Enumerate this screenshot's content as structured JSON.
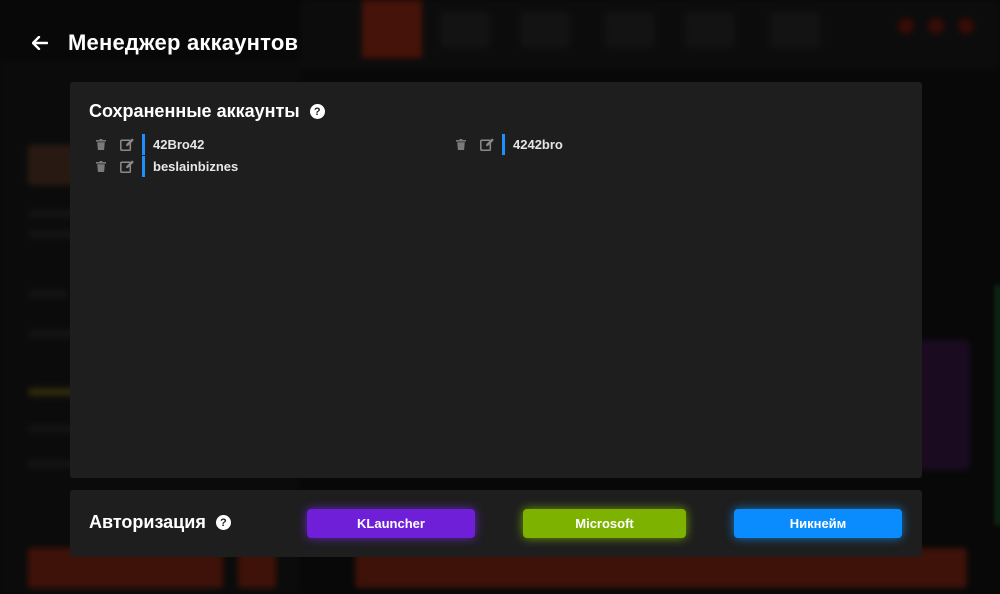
{
  "header": {
    "title": "Менеджер аккаунтов",
    "back_icon": "arrow-left-icon"
  },
  "saved_accounts": {
    "title": "Сохраненные аккаунты",
    "help_icon_glyph": "?",
    "accent_color": "#1e8fff",
    "accounts": [
      {
        "name": "42Bro42"
      },
      {
        "name": "4242bro"
      },
      {
        "name": "beslainbiznes"
      }
    ]
  },
  "authorization": {
    "title": "Авторизация",
    "help_icon_glyph": "?",
    "buttons": [
      {
        "label": "KLauncher",
        "color": "#6f1fd8"
      },
      {
        "label": "Microsoft",
        "color": "#7db300"
      },
      {
        "label": "Никнейм",
        "color": "#0a8cff"
      }
    ]
  }
}
